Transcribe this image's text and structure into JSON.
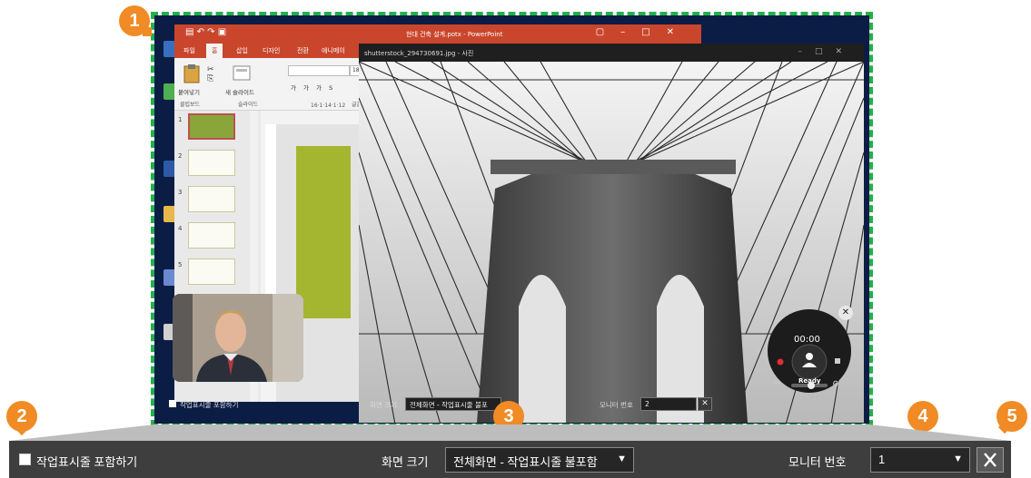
{
  "markers": [
    "1",
    "2",
    "3",
    "4",
    "5"
  ],
  "powerpoint": {
    "title": "현대 건축 설계.potx - PowerPoint",
    "tabs": [
      "파일",
      "홈",
      "삽입",
      "디자인",
      "전환",
      "애니메이"
    ],
    "active_tab": "홈",
    "ribbon": {
      "paste": "붙여넣기",
      "new_slide": "새 슬라이드",
      "group_clipboard": "클립보드",
      "group_slides": "슬라이드",
      "group_font": "글꼴",
      "font_size": "18"
    },
    "slide_numbers": [
      "1",
      "2",
      "3",
      "4",
      "5"
    ],
    "ruler_marks": "16·1·14·1·12"
  },
  "photo_viewer": {
    "title": "shutterstock_294730691.jpg - 사진"
  },
  "recorder": {
    "time": "00:00",
    "status": "Ready",
    "cam_label": "on"
  },
  "inner_bar": {
    "include_taskbar_label": "작업표시줄 포함하기",
    "screen_size_label": "화면 크기",
    "screen_size_value": "전체화면 - 작업표시줄 불포",
    "monitor_label": "모니터 번호",
    "monitor_value": "2"
  },
  "toolbar": {
    "include_taskbar_label": "작업표시줄 포함하기",
    "include_taskbar_checked": false,
    "screen_size_label": "화면 크기",
    "screen_size_value": "전체화면 - 작업표시줄 불포함",
    "monitor_label": "모니터 번호",
    "monitor_value": "1"
  },
  "colors": {
    "marker": "#f08b25",
    "frame": "#22b04a",
    "toolbar_bg": "#3e3e3e",
    "ppt_accent": "#c9462d"
  }
}
